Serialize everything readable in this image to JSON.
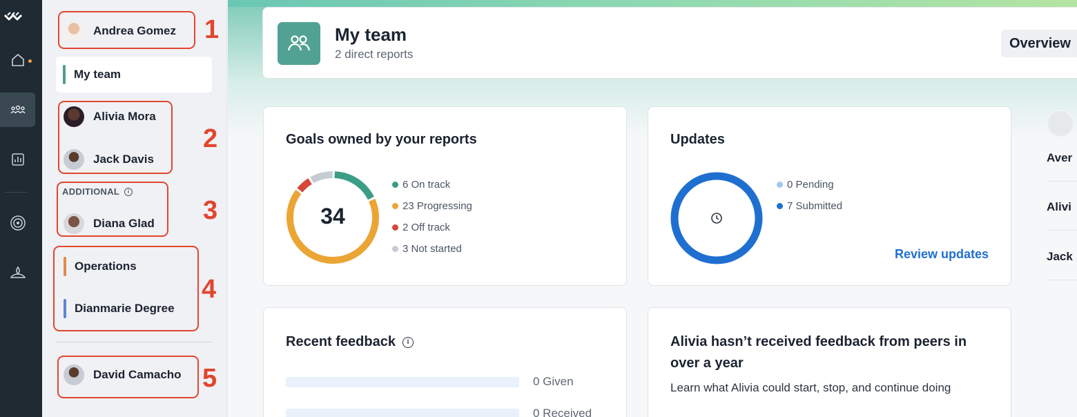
{
  "rail": {
    "icons": [
      "logo-icon",
      "home-icon",
      "team-icon",
      "chart-icon",
      "goal-icon",
      "wellbeing-icon"
    ]
  },
  "sidebar": {
    "me": "Andrea Gomez",
    "my_team": "My team",
    "reports": [
      "Alivia Mora",
      "Jack Davis"
    ],
    "additional_label": "ADDITIONAL",
    "additional": [
      "Diana Glad"
    ],
    "categories": [
      "Operations",
      "Dianmarie Degree"
    ],
    "manager": "David Camacho",
    "annotations": [
      "1",
      "2",
      "3",
      "4",
      "5"
    ]
  },
  "header": {
    "title": "My team",
    "subtitle": "2 direct reports",
    "overview_button": "Overview"
  },
  "goals": {
    "title": "Goals owned by your reports",
    "total": "34",
    "legend": [
      {
        "label": "6 On track",
        "color": "#3a9e86",
        "value": 6
      },
      {
        "label": "23 Progressing",
        "color": "#eaa535",
        "value": 23
      },
      {
        "label": "2 Off track",
        "color": "#d6473a",
        "value": 2
      },
      {
        "label": "3 Not started",
        "color": "#c5cbd3",
        "value": 3
      }
    ]
  },
  "updates": {
    "title": "Updates",
    "legend": [
      {
        "label": "0 Pending",
        "color": "#9ec8f3",
        "value": 0
      },
      {
        "label": "7 Submitted",
        "color": "#1f6fd1",
        "value": 7
      }
    ],
    "review_link": "Review updates"
  },
  "feedback": {
    "title": "Recent feedback",
    "given": "0 Given",
    "received": "0 Received"
  },
  "peer_card": {
    "title": "Alivia hasn’t received feedback from peers in over a year",
    "body": "Learn what Alivia could start, stop, and continue doing"
  },
  "right_panel": {
    "rows": [
      "Aver",
      "Alivi",
      "Jack"
    ]
  },
  "colors": {
    "accent_teal": "#52a293",
    "link_blue": "#1f6fd1",
    "annotation_red": "#e2452e",
    "ops_bar": "#e08a4e",
    "degree_bar": "#5d84d6",
    "team_bar": "#4f9e8c"
  }
}
